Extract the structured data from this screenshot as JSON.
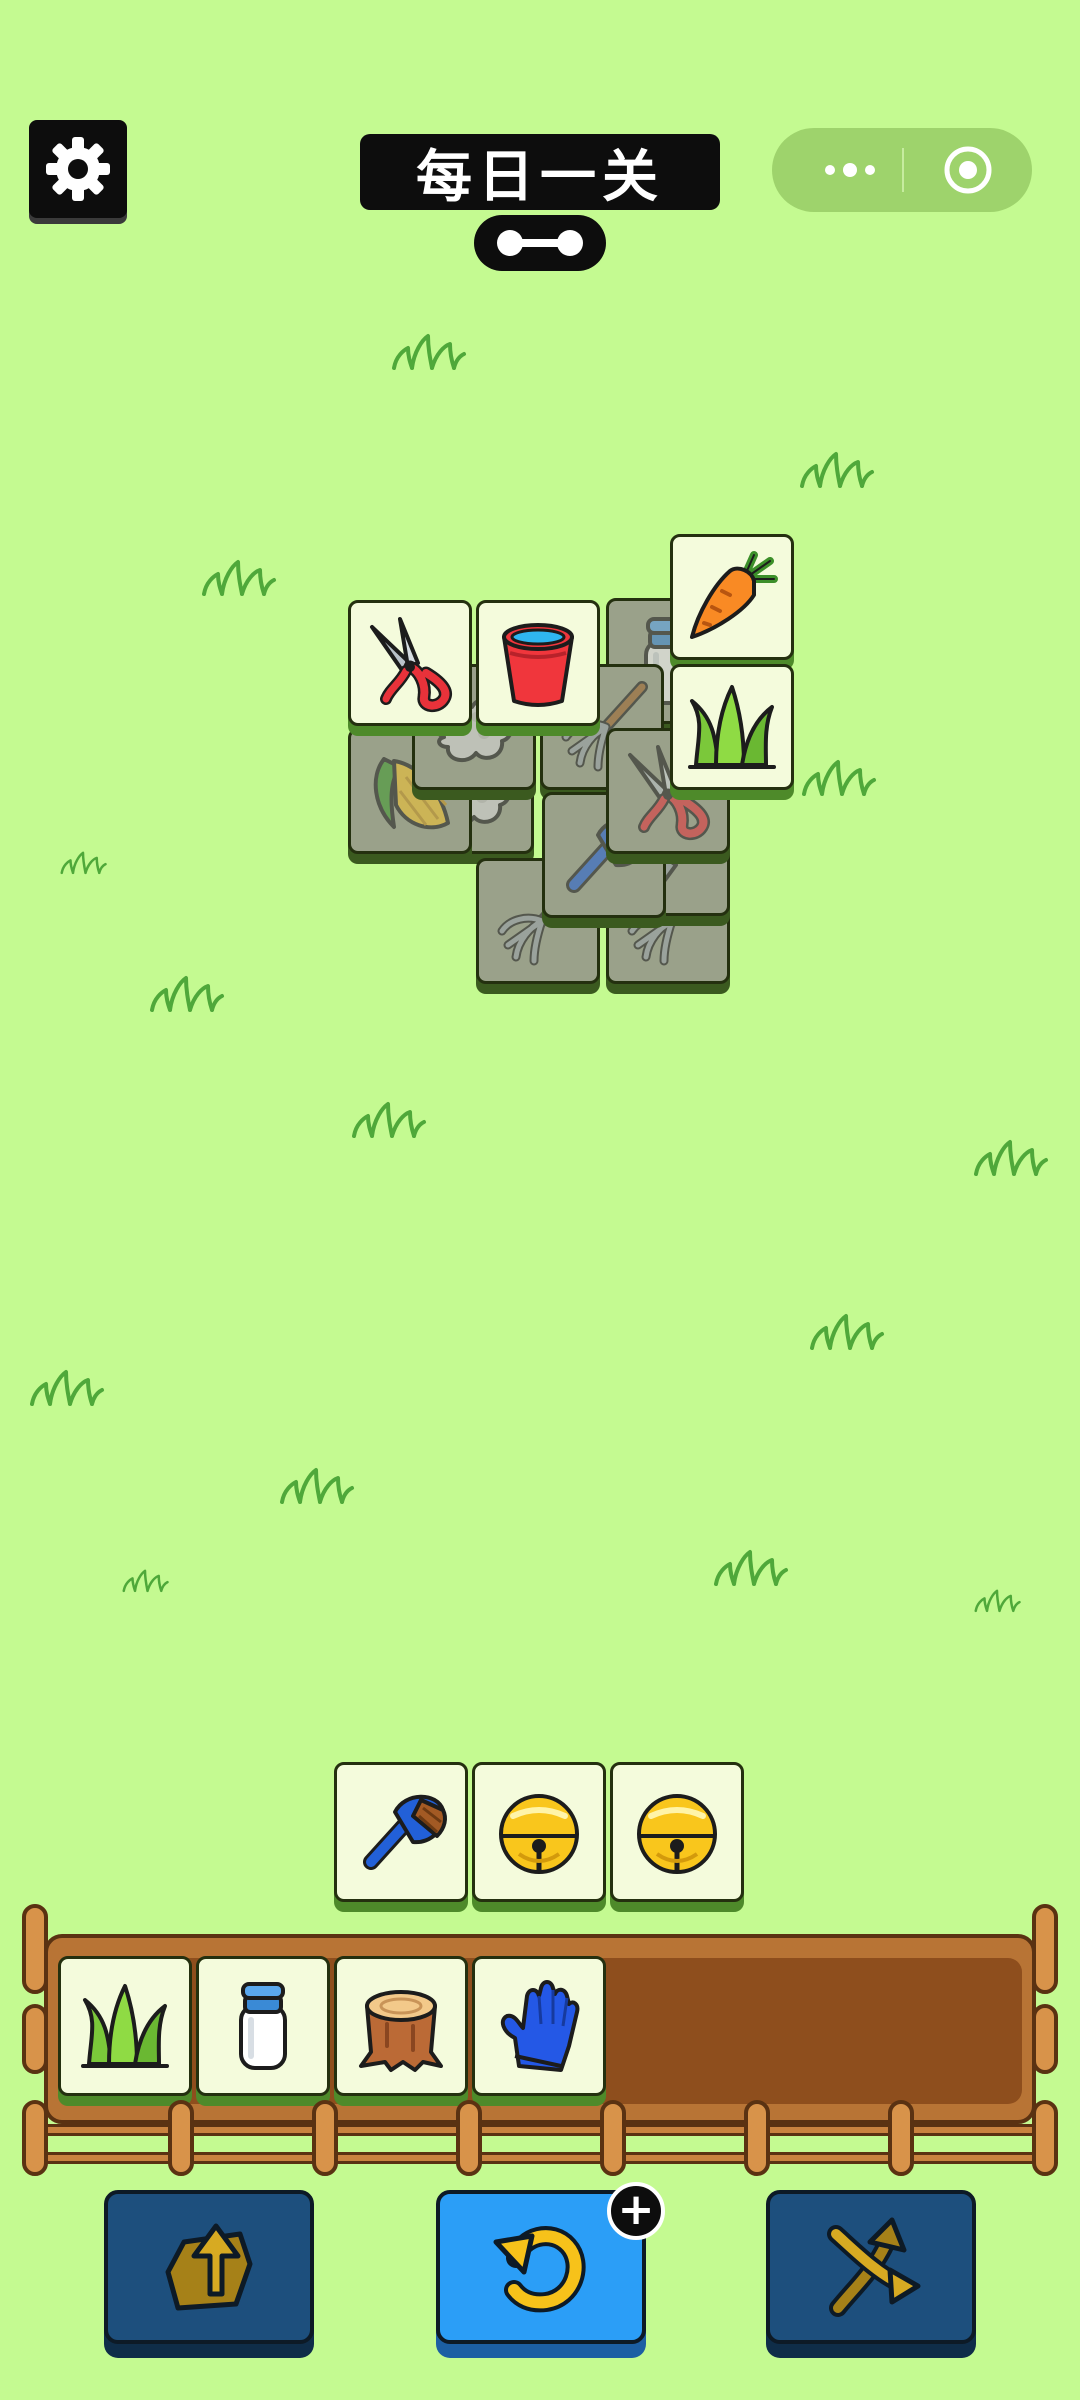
{
  "header": {
    "title": "每日一关",
    "settings_icon": "gear-icon",
    "progress_icon": "progress-dumbbell-icon",
    "capsule": {
      "more_icon": "more-dots-icon",
      "close_icon": "target-circle-icon"
    }
  },
  "board": {
    "free_tiles": [
      "pruning-shears",
      "red-bucket",
      "carrot",
      "grass"
    ],
    "covered_tiles": [
      "milk-bottle",
      "corn",
      "wool",
      "rake",
      "pruning-shears",
      "blue-brush",
      "rake",
      "rake",
      "wool",
      "shovel"
    ]
  },
  "staging_tiles": [
    "blue-brush",
    "golden-bell",
    "golden-bell"
  ],
  "slot_bar": {
    "capacity": 7,
    "tiles": [
      "grass",
      "milk-bottle",
      "tree-stump",
      "blue-glove"
    ]
  },
  "tools": [
    {
      "name": "move-out",
      "icon": "move-out-icon"
    },
    {
      "name": "undo",
      "icon": "undo-icon",
      "badge": "+"
    },
    {
      "name": "shuffle",
      "icon": "shuffle-icon"
    }
  ],
  "colors": {
    "background": "#c4fa91",
    "tile_face": "#f4fbdc",
    "tile_edge": "#4e8a2a",
    "slot_wood": "#b87435",
    "button_blue": "#2b9ef7",
    "button_dark": "#1d4f7d"
  }
}
